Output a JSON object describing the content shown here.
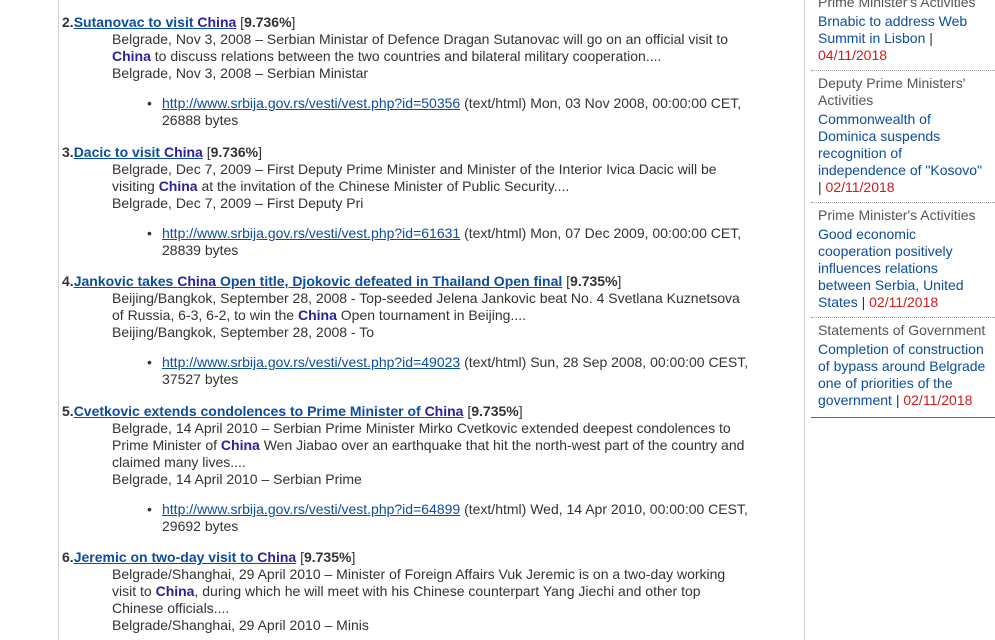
{
  "results": [
    {
      "num": "2.",
      "title_parts": [
        "Sutanovac to visit ",
        "China",
        ""
      ],
      "score": "9.736%",
      "snippet_parts": [
        "Belgrade, Nov 3, 2008 – Serbian Ministar of Defence Dragan Sutanovac will go on an official visit to ",
        "China",
        " to discuss relations between the two countries and bilateral military cooperation...."
      ],
      "snippet_tail": "Belgrade, Nov 3, 2008 – Serbian Ministar",
      "url": "http://www.srbija.gov.rs/vesti/vest.php?id=50356",
      "meta": " (text/html) Mon, 03 Nov 2008, 00:00:00 CET, 26888 bytes"
    },
    {
      "num": "3.",
      "title_parts": [
        "Dacic to visit ",
        "China",
        ""
      ],
      "score": "9.736%",
      "snippet_parts": [
        "Belgrade, Dec 7, 2009 – First Deputy Prime Minister and Minister of the Interior Ivica Dacic will be visiting ",
        "China",
        " at the invitation of the Chinese Minister of Public Security...."
      ],
      "snippet_tail": "Belgrade, Dec 7, 2009 – First Deputy Pri",
      "url": "http://www.srbija.gov.rs/vesti/vest.php?id=61631",
      "meta": " (text/html) Mon, 07 Dec 2009, 00:00:00 CET, 28839 bytes"
    },
    {
      "num": "4.",
      "title_parts": [
        "Jankovic takes ",
        "China",
        " Open title, Djokovic defeated in Thailand Open final"
      ],
      "score": "9.735%",
      "snippet_parts": [
        "Beijing/Bangkok, September 28, 2008 - Top-seeded Jelena Jankovic beat No. 4 Svetlana Kuznetsova of Russia, 6-3, 6-2, to win the ",
        "China",
        " Open tournament in Beijing...."
      ],
      "snippet_tail": "Beijing/Bangkok, September 28, 2008 - To",
      "url": "http://www.srbija.gov.rs/vesti/vest.php?id=49023",
      "meta": " (text/html) Sun, 28 Sep 2008, 00:00:00 CEST, 37527 bytes"
    },
    {
      "num": "5.",
      "title_parts": [
        "Cvetkovic extends condolences to Prime Minister of ",
        "China",
        ""
      ],
      "score": "9.735%",
      "snippet_parts": [
        "Belgrade, 14 April 2010 – Serbian Prime Minister Mirko Cvetkovic extended deepest condolences to Prime Minister of ",
        "China",
        " Wen Jiabao over an earthquake that hit the north-west part of the country and claimed many lives...."
      ],
      "snippet_tail": "Belgrade, 14 April 2010 – Serbian Prime",
      "url": "http://www.srbija.gov.rs/vesti/vest.php?id=64899",
      "meta": " (text/html) Wed, 14 Apr 2010, 00:00:00 CEST, 29692 bytes"
    },
    {
      "num": "6.",
      "title_parts": [
        "Jeremic on two-day visit to ",
        "China",
        ""
      ],
      "score": "9.735%",
      "snippet_parts": [
        "Belgrade/Shanghai, 29 April 2010 – Minister of Foreign Affairs Vuk Jeremic is on a two-day working visit to ",
        "China",
        ", during which he will meet with his Chinese counterpart Yang Jiechi and other top Chinese officials...."
      ],
      "snippet_tail": "Belgrade/Shanghai, 29 April 2010 – Minis",
      "url": "",
      "meta": ""
    }
  ],
  "sidebar": {
    "sections": [
      {
        "category": "Prime Minister's Activities",
        "link": "Brnabic to address Web Summit in Lisbon",
        "sep": " | ",
        "date": "04/11/2018"
      },
      {
        "category": "Deputy Prime Ministers' Activities",
        "link": "Commonwealth of Dominica suspends recognition of independence of \"Kosovo\"",
        "sep": " | ",
        "date": "02/11/2018"
      },
      {
        "category": "Prime Minister's Activities",
        "link": "Good economic cooperation positively influences relations between Serbia, United States",
        "sep": " | ",
        "date": "02/11/2018"
      },
      {
        "category": "Statements of Government",
        "link": "Completion of construction of bypass around Belgrade one of priorities of the government",
        "sep": " | ",
        "date": "02/11/2018"
      }
    ]
  }
}
